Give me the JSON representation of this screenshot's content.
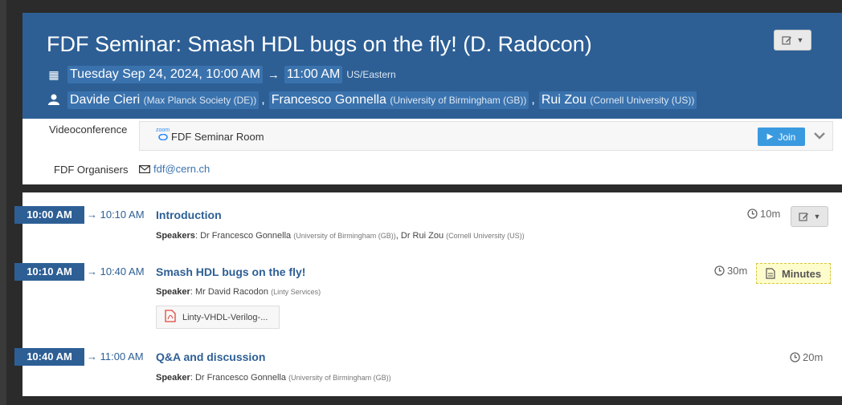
{
  "header": {
    "title": "FDF Seminar: Smash HDL bugs on the fly! (D. Radocon)",
    "date_start": "Tuesday Sep 24, 2024, 10:00 AM",
    "date_end": "11:00 AM",
    "timezone": "US/Eastern",
    "people": [
      {
        "name": "Davide Cieri",
        "affiliation": "(Max Planck Society (DE))"
      },
      {
        "name": "Francesco Gonnella",
        "affiliation": "(University of Birmingham (GB))"
      },
      {
        "name": "Rui Zou",
        "affiliation": "(Cornell University (US))"
      }
    ],
    "icons": {
      "calendar": "calendar-icon",
      "person": "person-icon",
      "edit": "edit-icon"
    }
  },
  "info": {
    "videoconference_label": "Videoconference",
    "zoom_logo": "zoom",
    "room_name": "FDF Seminar Room",
    "join_label": "Join",
    "organisers_label": "FDF Organisers",
    "organisers_email": "fdf@cern.ch"
  },
  "timetable": [
    {
      "start": "10:00 AM",
      "end": "→ 10:10 AM",
      "title": "Introduction",
      "speakers_label": "Speakers",
      "speakers": [
        {
          "name": "Dr Francesco Gonnella",
          "affiliation": "(University of Birmingham (GB))"
        },
        {
          "name": "Dr Rui Zou",
          "affiliation": "(Cornell University (US))"
        }
      ],
      "duration": "10m"
    },
    {
      "start": "10:10 AM",
      "end": "→ 10:40 AM",
      "title": "Smash HDL bugs on the fly!",
      "speakers_label": "Speaker",
      "speakers": [
        {
          "name": "Mr David Racodon",
          "affiliation": "(Linty Services)"
        }
      ],
      "duration": "30m",
      "minutes_label": "Minutes",
      "attachment": "Linty-VHDL-Verilog-..."
    },
    {
      "start": "10:40 AM",
      "end": "→ 11:00 AM",
      "title": "Q&A and discussion",
      "speakers_label": "Speaker",
      "speakers": [
        {
          "name": "Dr Francesco Gonnella",
          "affiliation": "(University of Birmingham (GB))"
        }
      ],
      "duration": "20m"
    }
  ],
  "colors": {
    "header_bg": "#2d5f95",
    "highlight": "#3a72ad",
    "join": "#3a9ae0",
    "minutes_bg": "#fdfccc"
  }
}
